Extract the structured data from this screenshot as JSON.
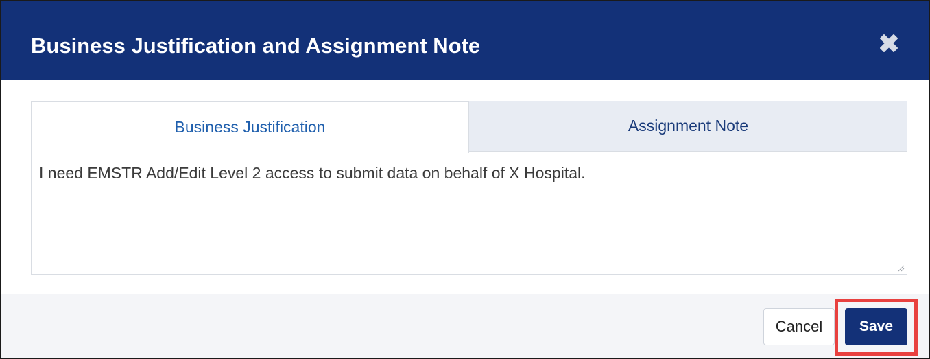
{
  "dialog": {
    "title": "Business Justification and Assignment Note"
  },
  "tabs": [
    {
      "label": "Business Justification",
      "active": true
    },
    {
      "label": "Assignment Note",
      "active": false
    }
  ],
  "justification_field": {
    "value": "I need EMSTR Add/Edit Level 2 access to submit data on behalf of X Hospital."
  },
  "footer": {
    "cancel_label": "Cancel",
    "save_label": "Save"
  },
  "icons": {
    "close": "close-icon",
    "resize": "resize-handle-icon"
  },
  "colors": {
    "header_bg": "#133178",
    "tab_active_text": "#1f5fad",
    "tab_inactive_bg": "#e8ecf3",
    "save_bg": "#133178",
    "highlight": "#e8413f",
    "footer_bg": "#f4f5f8"
  }
}
